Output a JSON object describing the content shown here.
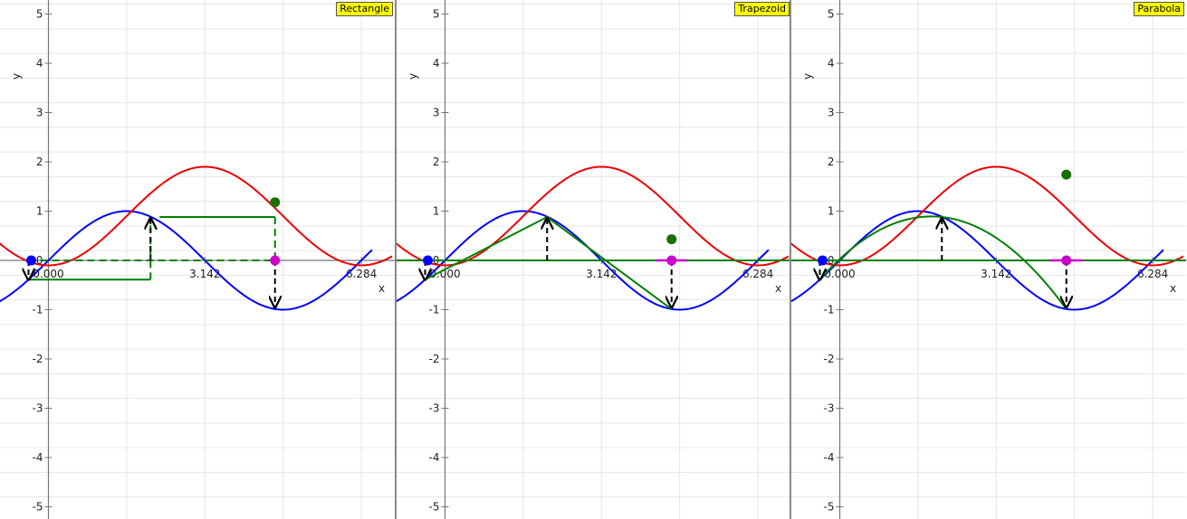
{
  "colors": {
    "sine": "#0000ff",
    "bump": "#ee0000",
    "approx": "#008000",
    "point": "#1a6e00",
    "start": "#0000ff",
    "end": "#cc00cc",
    "badge": "#ffff00",
    "grid": "#e6e6e6",
    "axis": "#777777"
  },
  "panels": [
    {
      "name": "panel-rectangle",
      "method_label": "Rectangle",
      "chart_data": {
        "type": "line",
        "xlabel": "x",
        "ylabel": "y",
        "xlim": [
          -1.0,
          6.9
        ],
        "ylim": [
          -5.3,
          5.3
        ],
        "x_ticks": [
          {
            "value": 0,
            "label": "0.000"
          },
          {
            "value": 3.142,
            "label": "3.142"
          },
          {
            "value": 6.284,
            "label": "6.284"
          }
        ],
        "y_ticks": [
          -5,
          -4,
          -3,
          -2,
          -1,
          0,
          1,
          2,
          3,
          4,
          5
        ],
        "grid": true,
        "series": [
          {
            "function": "sin(x)",
            "color": "blue",
            "x_range": [
              -1.0,
              6.5
            ]
          },
          {
            "function": "cos(x - 3.142) + 0.9",
            "color": "red",
            "x_range": [
              -1.0,
              6.9
            ]
          }
        ],
        "method": "rectangle",
        "start_x": -0.4,
        "end_x": 4.55,
        "eval_x": 2.05,
        "rect_heights": [
          -0.39,
          0.88
        ],
        "integral_point": {
          "x": 4.55,
          "y": 1.18
        }
      }
    },
    {
      "name": "panel-trapezoid",
      "method_label": "Trapezoid",
      "chart_data": {
        "type": "line",
        "xlabel": "x",
        "ylabel": "y",
        "xlim": [
          -1.0,
          6.9
        ],
        "ylim": [
          -5.3,
          5.3
        ],
        "x_ticks": [
          {
            "value": 0,
            "label": "0.000"
          },
          {
            "value": 3.142,
            "label": "3.142"
          },
          {
            "value": 6.284,
            "label": "6.284"
          }
        ],
        "y_ticks": [
          -5,
          -4,
          -3,
          -2,
          -1,
          0,
          1,
          2,
          3,
          4,
          5
        ],
        "grid": true,
        "series": [
          {
            "function": "sin(x)",
            "color": "blue",
            "x_range": [
              -1.0,
              6.5
            ]
          },
          {
            "function": "cos(x - 3.142) + 0.9",
            "color": "red",
            "x_range": [
              -1.0,
              6.9
            ]
          }
        ],
        "method": "trapezoid",
        "start_x": -0.4,
        "end_x": 4.55,
        "eval_x": 2.05,
        "approx_vertices": [
          {
            "x": -0.4,
            "y": -0.39
          },
          {
            "x": 2.05,
            "y": 0.88
          },
          {
            "x": 4.55,
            "y": -0.99
          }
        ],
        "integral_point": {
          "x": 4.55,
          "y": 0.43
        }
      }
    },
    {
      "name": "panel-parabola",
      "method_label": "Parabola",
      "chart_data": {
        "type": "line",
        "xlabel": "x",
        "ylabel": "y",
        "xlim": [
          -1.0,
          6.9
        ],
        "ylim": [
          -5.3,
          5.3
        ],
        "x_ticks": [
          {
            "value": 0,
            "label": "0.000"
          },
          {
            "value": 3.142,
            "label": "3.142"
          },
          {
            "value": 6.284,
            "label": "6.284"
          }
        ],
        "y_ticks": [
          -5,
          -4,
          -3,
          -2,
          -1,
          0,
          1,
          2,
          3,
          4,
          5
        ],
        "grid": true,
        "series": [
          {
            "function": "sin(x)",
            "color": "blue",
            "x_range": [
              -1.0,
              6.5
            ]
          },
          {
            "function": "cos(x - 3.142) + 0.9",
            "color": "red",
            "x_range": [
              -1.0,
              6.9
            ]
          }
        ],
        "method": "parabola",
        "start_x": -0.4,
        "end_x": 4.55,
        "eval_x": 2.05,
        "approx_vertices": [
          {
            "x": -0.4,
            "y": -0.39
          },
          {
            "x": 2.05,
            "y": 0.88
          },
          {
            "x": 4.55,
            "y": -0.99
          }
        ],
        "integral_point": {
          "x": 4.55,
          "y": 1.74
        }
      }
    }
  ]
}
